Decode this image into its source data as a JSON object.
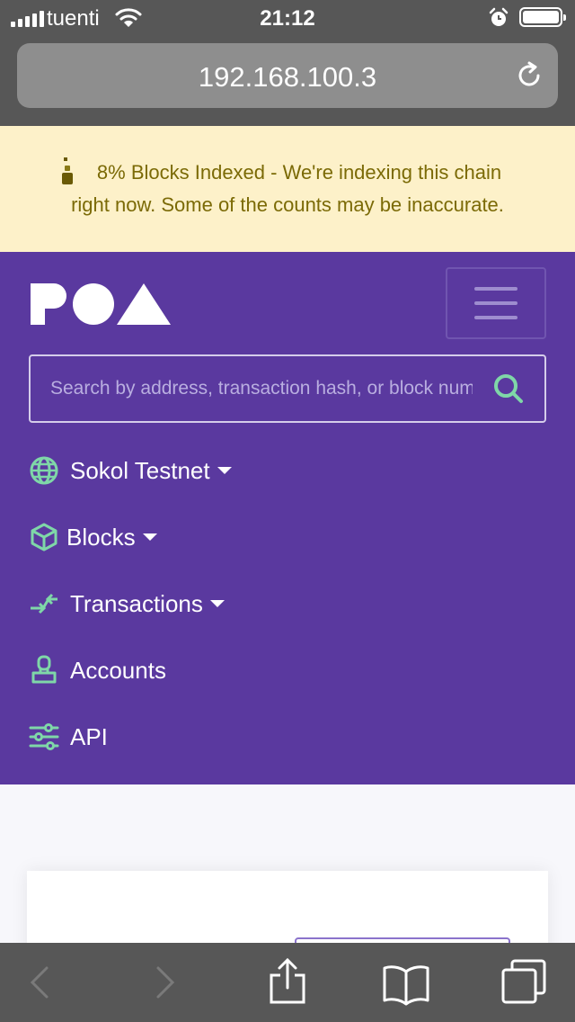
{
  "status_bar": {
    "carrier": "tuenti",
    "time": "21:12"
  },
  "browser": {
    "url": "192.168.100.3"
  },
  "banner": {
    "line1": "8% Blocks Indexed - We're indexing this chain",
    "line2": "right now. Some of the counts may be inaccurate."
  },
  "header": {
    "logo": "POA",
    "search_placeholder": "Search by address, transaction hash, or block number"
  },
  "nav": {
    "items": [
      {
        "label": "Sokol Testnet",
        "icon": "globe-icon",
        "dropdown": true
      },
      {
        "label": "Blocks",
        "icon": "cube-icon",
        "dropdown": true
      },
      {
        "label": "Transactions",
        "icon": "arrows-exchange-icon",
        "dropdown": true
      },
      {
        "label": "Accounts",
        "icon": "stamp-icon",
        "dropdown": false
      },
      {
        "label": "API",
        "icon": "sliders-icon",
        "dropdown": false
      }
    ]
  },
  "colors": {
    "nav_bg": "#5a399f",
    "accent": "#7fd7a8",
    "banner_bg": "#fdf1c9",
    "banner_text": "#7b6a06"
  }
}
